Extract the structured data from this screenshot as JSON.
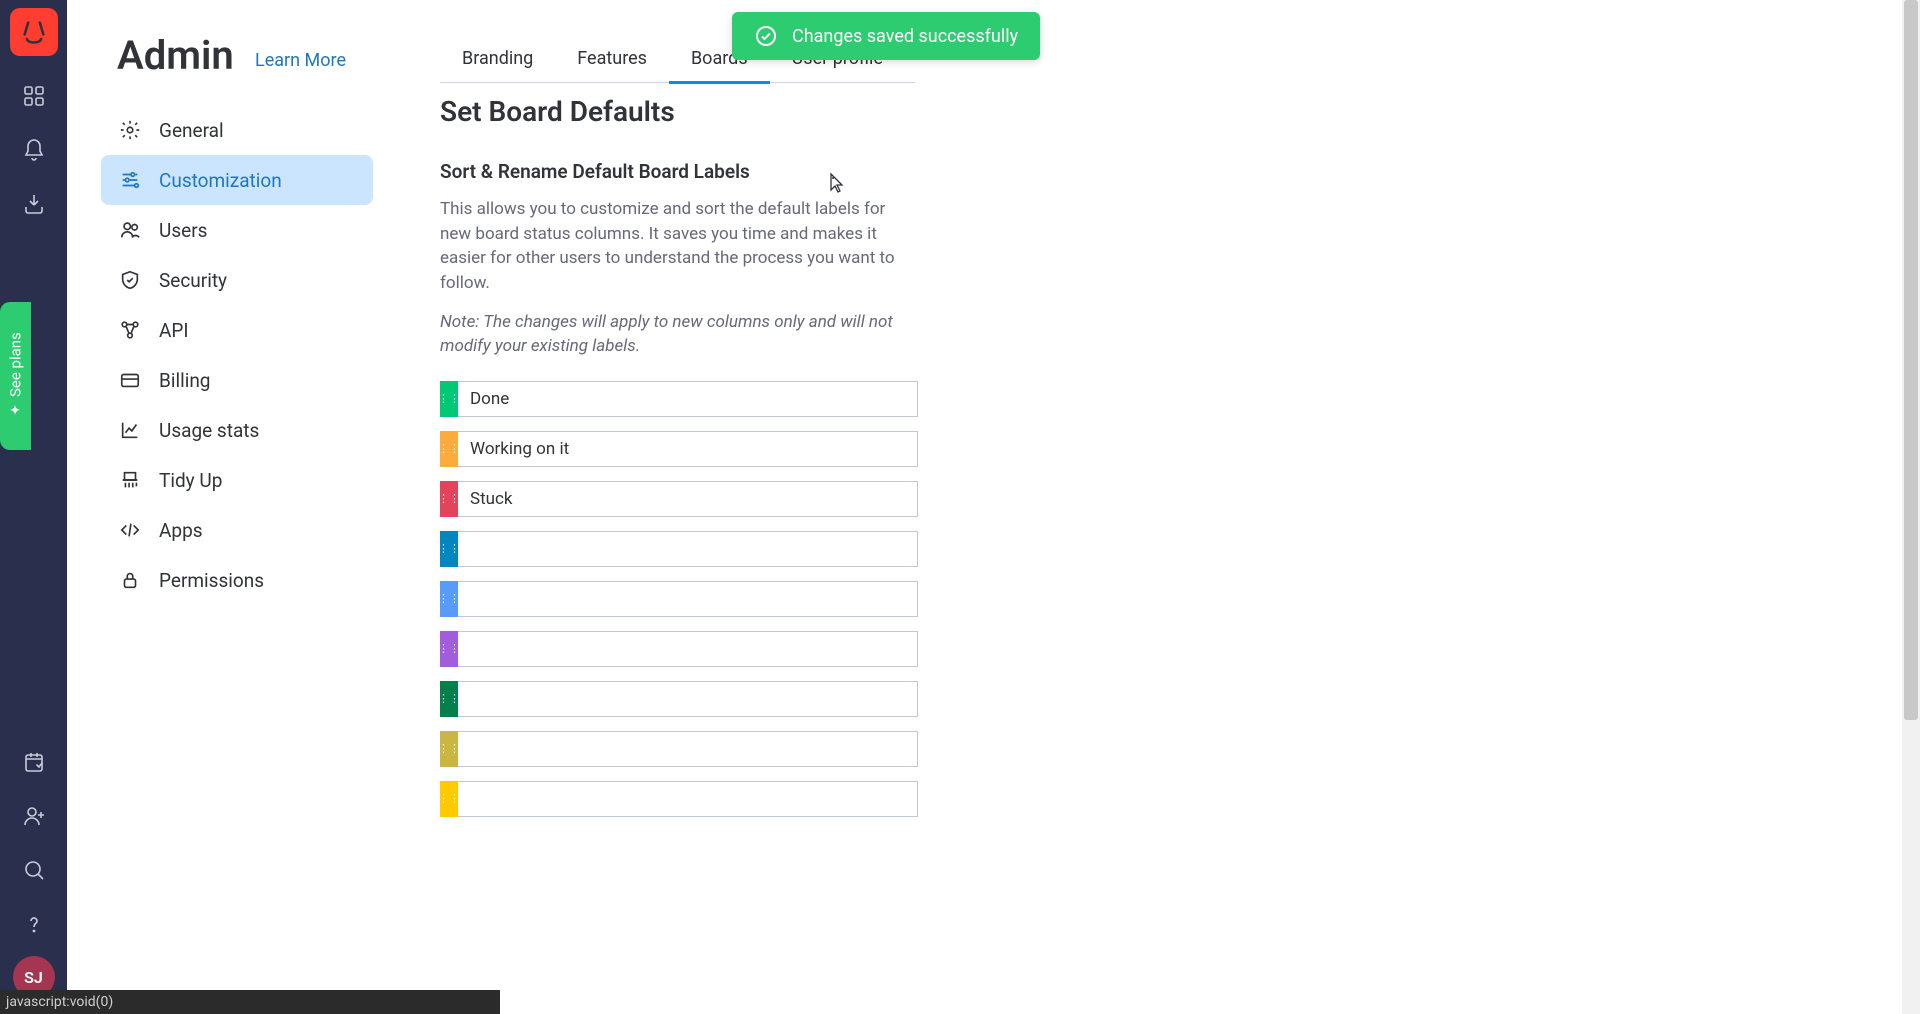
{
  "rail": {
    "avatar_initials": "SJ",
    "see_plans_label": "See plans"
  },
  "header": {
    "title": "Admin",
    "learn_more": "Learn More"
  },
  "sidebar": {
    "items": [
      {
        "label": "General"
      },
      {
        "label": "Customization"
      },
      {
        "label": "Users"
      },
      {
        "label": "Security"
      },
      {
        "label": "API"
      },
      {
        "label": "Billing"
      },
      {
        "label": "Usage stats"
      },
      {
        "label": "Tidy Up"
      },
      {
        "label": "Apps"
      },
      {
        "label": "Permissions"
      }
    ],
    "active_index": 1
  },
  "tabs": {
    "items": [
      {
        "label": "Branding"
      },
      {
        "label": "Features"
      },
      {
        "label": "Boards"
      },
      {
        "label": "User profile"
      }
    ],
    "active_index": 2
  },
  "toast": {
    "message": "Changes saved successfully"
  },
  "content": {
    "title": "Set Board Defaults",
    "subtitle": "Sort & Rename Default Board Labels",
    "description": "This allows you to customize and sort the default labels for new board status columns. It saves you time and makes it easier for other users to understand the process you want to follow.",
    "note": "Note: The changes will apply to new columns only and will not modify your existing labels.",
    "labels": [
      {
        "color": "#00c875",
        "value": "Done"
      },
      {
        "color": "#fdab3d",
        "value": "Working on it"
      },
      {
        "color": "#e2445c",
        "value": "Stuck"
      },
      {
        "color": "#0086c0",
        "value": ""
      },
      {
        "color": "#579bfc",
        "value": ""
      },
      {
        "color": "#a25ddc",
        "value": ""
      },
      {
        "color": "#037f4c",
        "value": ""
      },
      {
        "color": "#cab641",
        "value": ""
      },
      {
        "color": "#ffcb00",
        "value": ""
      }
    ]
  },
  "statusbar": {
    "text": "javascript:void(0)"
  }
}
